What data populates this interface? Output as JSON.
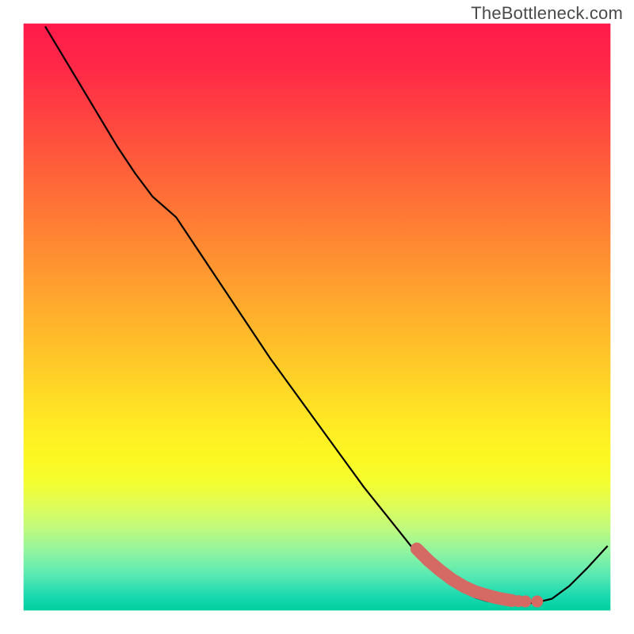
{
  "watermark": "TheBottleneck.com",
  "chart_data": {
    "type": "line",
    "title": "",
    "xlabel": "",
    "ylabel": "",
    "xlim": [
      0,
      100
    ],
    "ylim": [
      0,
      100
    ],
    "x": [
      3.7,
      7,
      10,
      13,
      16,
      19,
      22,
      26,
      30,
      34,
      38,
      42,
      46,
      50,
      54,
      58,
      62,
      66,
      69,
      72,
      75,
      77,
      79,
      81,
      83,
      85,
      87,
      90,
      93,
      96,
      99.5
    ],
    "values": [
      99.5,
      94,
      89,
      84,
      79,
      74.5,
      70.5,
      67,
      61,
      55,
      49,
      43,
      37.5,
      32,
      26.5,
      21,
      16,
      11,
      7.5,
      5,
      3.2,
      2.2,
      1.6,
      1.3,
      1.2,
      1.2,
      1.3,
      2,
      4.2,
      7.2,
      11
    ],
    "gradient_stops": [
      {
        "offset": 0.0,
        "color": "#ff1a4b"
      },
      {
        "offset": 0.08,
        "color": "#ff2a47"
      },
      {
        "offset": 0.18,
        "color": "#ff4a3f"
      },
      {
        "offset": 0.28,
        "color": "#ff6a38"
      },
      {
        "offset": 0.38,
        "color": "#ff8a32"
      },
      {
        "offset": 0.48,
        "color": "#ffaa2d"
      },
      {
        "offset": 0.58,
        "color": "#ffca28"
      },
      {
        "offset": 0.68,
        "color": "#ffe924"
      },
      {
        "offset": 0.74,
        "color": "#fcf823"
      },
      {
        "offset": 0.78,
        "color": "#f4fd2f"
      },
      {
        "offset": 0.82,
        "color": "#e0fd56"
      },
      {
        "offset": 0.86,
        "color": "#c0fa7e"
      },
      {
        "offset": 0.9,
        "color": "#90f4a0"
      },
      {
        "offset": 0.94,
        "color": "#58e9b2"
      },
      {
        "offset": 0.975,
        "color": "#1bd9b0"
      },
      {
        "offset": 1.0,
        "color": "#00cf9f"
      }
    ],
    "highlight_segment": {
      "x": [
        67,
        69,
        71,
        73,
        75,
        77,
        79,
        80.5,
        82,
        83.2
      ],
      "y": [
        10.5,
        8.5,
        6.8,
        5.3,
        4.1,
        3.2,
        2.6,
        2.2,
        1.9,
        1.7
      ],
      "color": "#d46a63"
    },
    "highlight_dots": {
      "points": [
        {
          "x": 84.3,
          "y": 1.6
        },
        {
          "x": 85.5,
          "y": 1.55
        },
        {
          "x": 87.5,
          "y": 1.55
        }
      ],
      "color": "#d46a63"
    },
    "plot_margin_frac": 0.037,
    "line_color": "#000000"
  }
}
